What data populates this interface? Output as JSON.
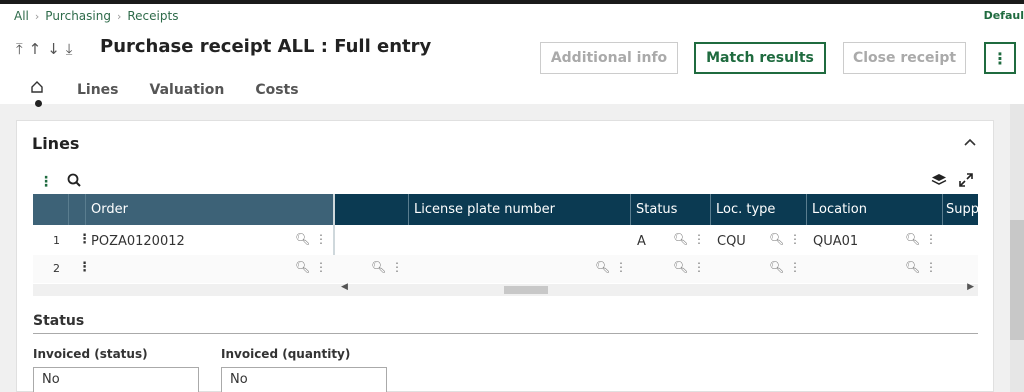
{
  "breadcrumb": [
    "All",
    "Purchasing",
    "Receipts"
  ],
  "user_label": "Defaul",
  "nav_arrows": [
    "⤒",
    "↑",
    "↓",
    "⤓"
  ],
  "page_title": "Purchase receipt ALL : Full entry",
  "actions": {
    "additional_info": "Additional info",
    "match_results": "Match results",
    "close_receipt": "Close receipt",
    "more": "⋮"
  },
  "tabs": [
    "Lines",
    "Valuation",
    "Costs"
  ],
  "section": {
    "title": "Lines",
    "collapse_icon": "^"
  },
  "grid": {
    "columns": [
      "Order",
      "License plate number",
      "Status",
      "Loc. type",
      "Location",
      "Supp"
    ],
    "rows": [
      {
        "num": "1",
        "order": "POZA0120012",
        "license": "",
        "status": "A",
        "loc_type": "CQU",
        "location": "QUA01"
      },
      {
        "num": "2",
        "order": "",
        "license": "",
        "status": "",
        "loc_type": "",
        "location": ""
      }
    ]
  },
  "status_section": {
    "title": "Status",
    "fields": [
      {
        "label": "Invoiced (status)",
        "value": "No"
      },
      {
        "label": "Invoiced (quantity)",
        "value": "No"
      }
    ]
  },
  "colors": {
    "accent": "#1f6b3f",
    "grid_header": "#0b3a52",
    "grid_header_frozen": "#3d6277"
  }
}
